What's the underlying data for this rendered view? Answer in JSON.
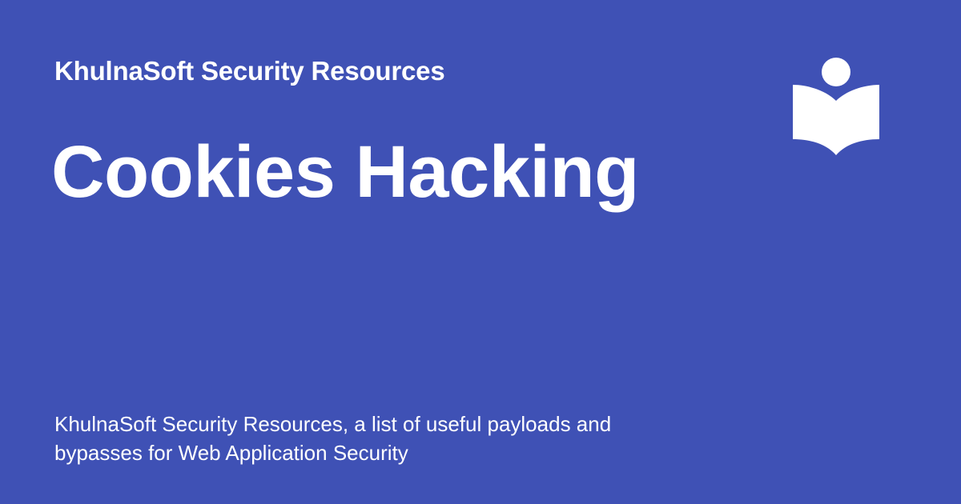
{
  "site": {
    "name": "KhulnaSoft Security Resources",
    "logo_icon": "reading-book-icon"
  },
  "page": {
    "title": "Cookies Hacking",
    "description": "KhulnaSoft Security Resources, a list of useful payloads and bypasses for Web Application Security"
  },
  "colors": {
    "background": "#3f51b5",
    "foreground": "#ffffff"
  }
}
